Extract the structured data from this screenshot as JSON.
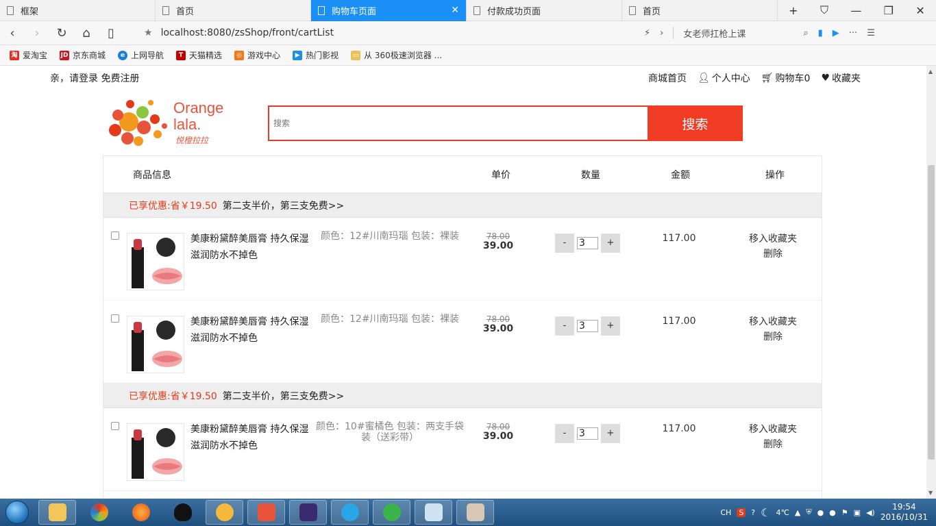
{
  "browser": {
    "tabs": [
      {
        "title": "框架",
        "active": false
      },
      {
        "title": "首页",
        "active": false
      },
      {
        "title": "购物车页面",
        "active": true
      },
      {
        "title": "付款成功页面",
        "active": false
      },
      {
        "title": "首页",
        "active": false
      }
    ],
    "url": "localhost:8080/zsShop/front/cartList",
    "search_hint": "女老师扛枪上课",
    "bookmarks": [
      {
        "label": "爱淘宝",
        "color": "#e0302a",
        "glyph": "淘"
      },
      {
        "label": "京东商城",
        "color": "#c81623",
        "glyph": "JD"
      },
      {
        "label": "上网导航",
        "color": "#1b7fd8",
        "glyph": "e"
      },
      {
        "label": "天猫精选",
        "color": "#c40000",
        "glyph": "T"
      },
      {
        "label": "游戏中心",
        "color": "#f07a1a",
        "glyph": "◎"
      },
      {
        "label": "热门影视",
        "color": "#1f8fe3",
        "glyph": "▶"
      },
      {
        "label": "从 360极速浏览器 ...",
        "color": "#e8c35a",
        "glyph": "▭"
      }
    ]
  },
  "site": {
    "login_text": "亲，请登录 免费注册",
    "nav": {
      "home": "商城首页",
      "user": "个人中心",
      "cart": "购物车0",
      "favorites": "收藏夹"
    },
    "logo": {
      "brand_line1": "Orange",
      "brand_line2": "lala.",
      "brand_cn": "悦橙拉拉"
    },
    "search": {
      "placeholder": "搜索",
      "button": "搜索"
    }
  },
  "cart": {
    "headers": {
      "info": "商品信息",
      "unit_price": "单价",
      "quantity": "数量",
      "amount": "金额",
      "action": "操作"
    },
    "groups": [
      {
        "promo_label": "已享优惠:省￥19.50",
        "promo_desc": "第二支半价，第三支免费>>",
        "items": [
          {
            "name": "美康粉黛醉美唇膏 持久保湿滋润防水不掉色",
            "spec": "颜色：12#川南玛瑙 包装：裸装",
            "old_price": "78.00",
            "price": "39.00",
            "qty": "3",
            "amount": "117.00",
            "fav": "移入收藏夹",
            "del": "删除"
          },
          {
            "name": "美康粉黛醉美唇膏 持久保湿滋润防水不掉色",
            "spec": "颜色：12#川南玛瑙 包装：裸装",
            "old_price": "78.00",
            "price": "39.00",
            "qty": "3",
            "amount": "117.00",
            "fav": "移入收藏夹",
            "del": "删除"
          }
        ]
      },
      {
        "promo_label": "已享优惠:省￥19.50",
        "promo_desc": "第二支半价，第三支免费>>",
        "items": [
          {
            "name": "美康粉黛醉美唇膏 持久保湿滋润防水不掉色",
            "spec": "颜色：10#蜜橘色 包装：两支手袋装（送彩带）",
            "old_price": "78.00",
            "price": "39.00",
            "qty": "3",
            "amount": "117.00",
            "fav": "移入收藏夹",
            "del": "删除"
          }
        ]
      }
    ],
    "qty_minus": "-",
    "qty_plus": "+"
  },
  "taskbar": {
    "time": "19:54",
    "date": "2016/10/31",
    "temp": "4℃",
    "lang": "CH"
  }
}
